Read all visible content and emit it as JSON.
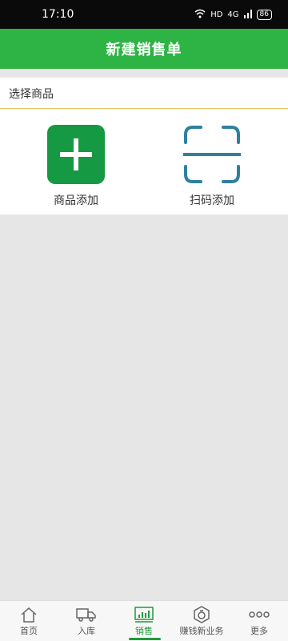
{
  "status_bar": {
    "time": "17:10",
    "network": "HD",
    "signal": "4G",
    "battery": "86"
  },
  "app_bar": {
    "title": "新建销售单"
  },
  "section": {
    "label": "选择商品"
  },
  "add_options": {
    "manual_label": "商品添加",
    "scan_label": "扫码添加"
  },
  "colors": {
    "primary": "#2db444",
    "manual_icon": "#159a43",
    "scan_icon": "#2f7f9f",
    "nav_active": "#1f9a3a"
  },
  "bottom_nav": {
    "items": [
      {
        "label": "首页",
        "icon": "home-icon",
        "active": false
      },
      {
        "label": "入库",
        "icon": "truck-icon",
        "active": false
      },
      {
        "label": "销售",
        "icon": "sales-chart-icon",
        "active": true
      },
      {
        "label": "赚钱新业务",
        "icon": "money-bag-icon",
        "active": false
      },
      {
        "label": "更多",
        "icon": "more-dots-icon",
        "active": false
      }
    ]
  }
}
